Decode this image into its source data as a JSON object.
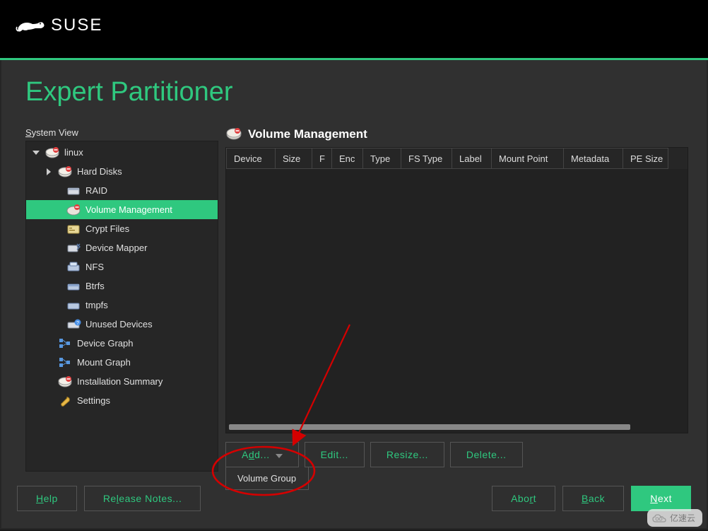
{
  "brand": "SUSE",
  "page_title": "Expert Partitioner",
  "tree_label": {
    "pre": "S",
    "post": "ystem View"
  },
  "tree": [
    {
      "label": "linux",
      "icon": "disk-red",
      "indent": 0,
      "expanded": true
    },
    {
      "label": "Hard Disks",
      "icon": "disk-red",
      "indent": 1,
      "expander": "right"
    },
    {
      "label": "RAID",
      "icon": "drive",
      "indent": 2
    },
    {
      "label": "Volume Management",
      "icon": "vol",
      "indent": 2,
      "selected": true
    },
    {
      "label": "Crypt Files",
      "icon": "crypt",
      "indent": 2
    },
    {
      "label": "Device Mapper",
      "icon": "mapper",
      "indent": 2
    },
    {
      "label": "NFS",
      "icon": "nfs",
      "indent": 2
    },
    {
      "label": "Btrfs",
      "icon": "btrfs",
      "indent": 2
    },
    {
      "label": "tmpfs",
      "icon": "tmpfs",
      "indent": 2
    },
    {
      "label": "Unused Devices",
      "icon": "unused",
      "indent": 2
    },
    {
      "label": "Device Graph",
      "icon": "graph",
      "indent": 1
    },
    {
      "label": "Mount Graph",
      "icon": "graph",
      "indent": 1
    },
    {
      "label": "Installation Summary",
      "icon": "disk-red",
      "indent": 1
    },
    {
      "label": "Settings",
      "icon": "wrench",
      "indent": 1
    }
  ],
  "section_title": "Volume Management",
  "columns": [
    "Device",
    "Size",
    "F",
    "Enc",
    "Type",
    "FS Type",
    "Label",
    "Mount Point",
    "Metadata",
    "PE Size"
  ],
  "actions": {
    "add": {
      "pre": "A",
      "ul": "d",
      "post": "d..."
    },
    "edit": {
      "ul": "E",
      "post": "dit..."
    },
    "resize": {
      "pre": "Resi",
      "ul": "z",
      "post": "e..."
    },
    "delete": {
      "pre": "Dele",
      "ul": "t",
      "post": "e..."
    }
  },
  "dropdown_item": "Volume Group",
  "footer": {
    "help": {
      "ul": "H",
      "post": "elp"
    },
    "release": {
      "pre": "Re",
      "ul": "l",
      "post": "ease Notes..."
    },
    "abort": {
      "pre": "Abo",
      "ul": "r",
      "post": "t"
    },
    "back": {
      "ul": "B",
      "post": "ack"
    },
    "next": {
      "ul": "N",
      "post": "ext"
    }
  },
  "watermark": "亿速云"
}
